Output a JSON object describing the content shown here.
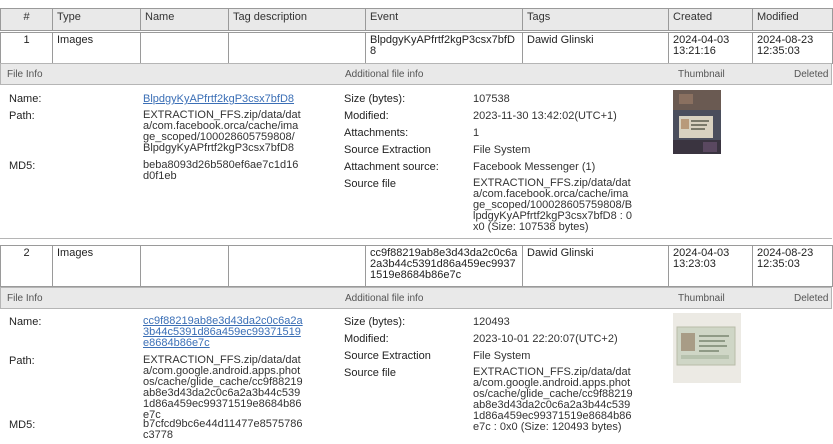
{
  "columns": {
    "num": "#",
    "type": "Type",
    "name": "Name",
    "tag_description": "Tag description",
    "event": "Event",
    "tags": "Tags",
    "created": "Created",
    "modified": "Modified"
  },
  "section_labels": {
    "file_info": "File Info",
    "additional": "Additional file info",
    "thumbnail": "Thumbnail",
    "deleted": "Deleted"
  },
  "records": [
    {
      "num": "1",
      "type": "Images",
      "name": "",
      "tag_description": "",
      "event": "BlpdgyKyAPfrtf2kgP3csx7bfD8",
      "tags": "Dawid Glinski",
      "created": "2024-04-03 13:21:16",
      "modified": "2024-08-23 12:35:03",
      "file_info": {
        "name_label": "Name:",
        "name_value": "BlpdgyKyAPfrtf2kgP3csx7bfD8",
        "path_label": "Path:",
        "path_value": "EXTRACTION_FFS.zip/data/data/com.facebook.orca/cache/image_scoped/100028605759808/BlpdgyKyAPfrtf2kgP3csx7bfD8",
        "md5_label": "MD5:",
        "md5_value": "beba8093d26b580ef6ae7c1d16d0f1eb"
      },
      "additional": {
        "size_label": "Size (bytes):",
        "size_value": "107538",
        "modified_label": "Modified:",
        "modified_value": "2023-11-30 13:42:02(UTC+1)",
        "attachments_label": "Attachments:",
        "attachments_value": "1",
        "source_extraction_label": "Source Extraction",
        "source_extraction_value": "File System",
        "attachment_source_label": "Attachment source:",
        "attachment_source_value": "Facebook Messenger (1)",
        "source_file_label": "Source file",
        "source_file_value": "EXTRACTION_FFS.zip/data/data/com.facebook.orca/cache/image_scoped/100028605759808/BlpdgyKyAPfrtf2kgP3csx7bfD8 : 0x0 (Size: 107538 bytes)"
      }
    },
    {
      "num": "2",
      "type": "Images",
      "name": "",
      "tag_description": "",
      "event": "cc9f88219ab8e3d43da2c0c6a2a3b44c5391d86a459ec99371519e8684b86e7c",
      "tags": "Dawid Glinski",
      "created": "2024-04-03 13:23:03",
      "modified": "2024-08-23 12:35:03",
      "file_info": {
        "name_label": "Name:",
        "name_value": "cc9f88219ab8e3d43da2c0c6a2a3b44c5391d86a459ec99371519e8684b86e7c",
        "path_label": "Path:",
        "path_value": "EXTRACTION_FFS.zip/data/data/com.google.android.apps.photos/cache/glide_cache/cc9f88219ab8e3d43da2c0c6a2a3b44c5391d86a459ec99371519e8684b86e7c",
        "md5_label": "MD5:",
        "md5_value": "b7cfcd9bc6e44d11477e8575786c3778"
      },
      "additional": {
        "size_label": "Size (bytes):",
        "size_value": "120493",
        "modified_label": "Modified:",
        "modified_value": "2023-10-01 22:20:07(UTC+2)",
        "source_extraction_label": "Source Extraction",
        "source_extraction_value": "File System",
        "source_file_label": "Source file",
        "source_file_value": "EXTRACTION_FFS.zip/data/data/com.google.android.apps.photos/cache/glide_cache/cc9f88219ab8e3d43da2c0c6a2a3b44c5391d86a459ec99371519e8684b86e7c : 0x0 (Size: 120493 bytes)"
      }
    }
  ]
}
